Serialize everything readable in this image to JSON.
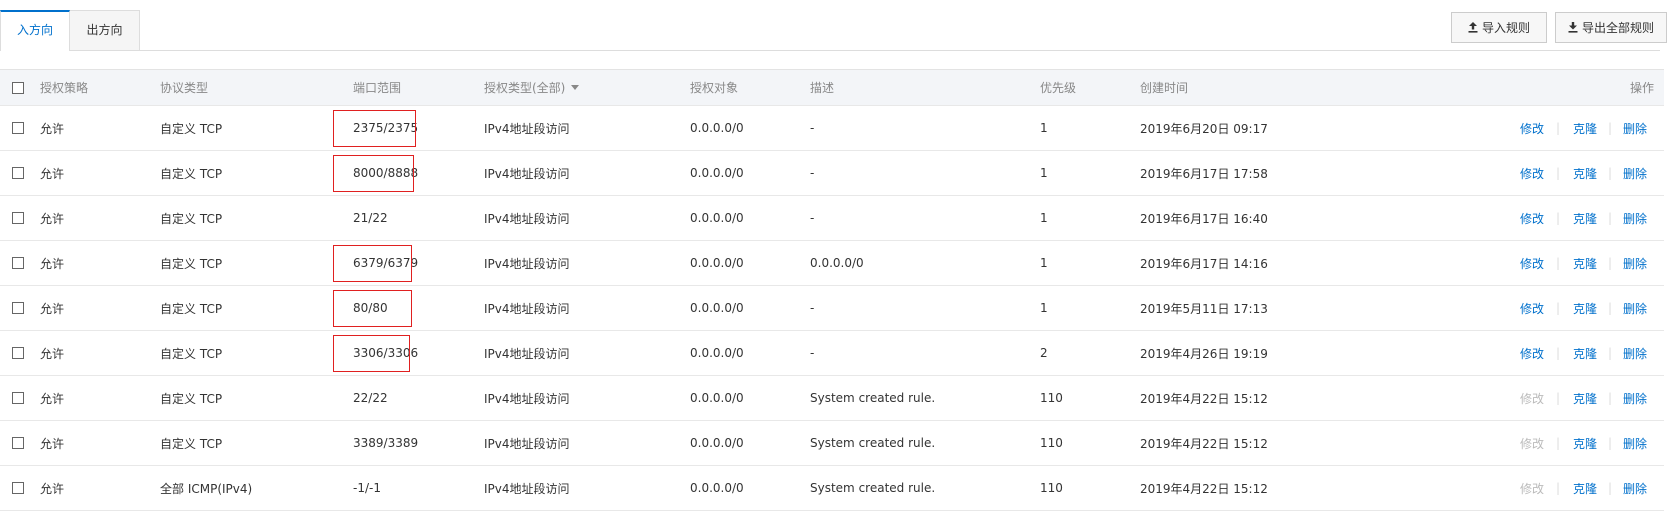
{
  "tabs": [
    {
      "label": "入方向",
      "active": true
    },
    {
      "label": "出方向",
      "active": false
    }
  ],
  "toolbar": {
    "import_label": "导入规则",
    "export_label": "导出全部规则"
  },
  "table": {
    "headers": {
      "policy": "授权策略",
      "protocol": "协议类型",
      "port": "端口范围",
      "auth_type": "授权类型(全部)",
      "target": "授权对象",
      "description": "描述",
      "priority": "优先级",
      "created": "创建时间",
      "ops": "操作"
    },
    "ops_labels": {
      "edit": "修改",
      "clone": "克隆",
      "delete": "删除",
      "separator": "|"
    },
    "rows": [
      {
        "policy": "允许",
        "protocol": "自定义 TCP",
        "port": "2375/2375",
        "auth_type": "IPv4地址段访问",
        "target": "0.0.0.0/0",
        "description": "-",
        "priority": "1",
        "created": "2019年6月20日 09:17",
        "edit_enabled": true,
        "highlighted": true
      },
      {
        "policy": "允许",
        "protocol": "自定义 TCP",
        "port": "8000/8888",
        "auth_type": "IPv4地址段访问",
        "target": "0.0.0.0/0",
        "description": "-",
        "priority": "1",
        "created": "2019年6月17日 17:58",
        "edit_enabled": true,
        "highlighted": true
      },
      {
        "policy": "允许",
        "protocol": "自定义 TCP",
        "port": "21/22",
        "auth_type": "IPv4地址段访问",
        "target": "0.0.0.0/0",
        "description": "-",
        "priority": "1",
        "created": "2019年6月17日 16:40",
        "edit_enabled": true,
        "highlighted": false
      },
      {
        "policy": "允许",
        "protocol": "自定义 TCP",
        "port": "6379/6379",
        "auth_type": "IPv4地址段访问",
        "target": "0.0.0.0/0",
        "description": "0.0.0.0/0",
        "priority": "1",
        "created": "2019年6月17日 14:16",
        "edit_enabled": true,
        "highlighted": true
      },
      {
        "policy": "允许",
        "protocol": "自定义 TCP",
        "port": "80/80",
        "auth_type": "IPv4地址段访问",
        "target": "0.0.0.0/0",
        "description": "-",
        "priority": "1",
        "created": "2019年5月11日 17:13",
        "edit_enabled": true,
        "highlighted": true
      },
      {
        "policy": "允许",
        "protocol": "自定义 TCP",
        "port": "3306/3306",
        "auth_type": "IPv4地址段访问",
        "target": "0.0.0.0/0",
        "description": "-",
        "priority": "2",
        "created": "2019年4月26日 19:19",
        "edit_enabled": true,
        "highlighted": true
      },
      {
        "policy": "允许",
        "protocol": "自定义 TCP",
        "port": "22/22",
        "auth_type": "IPv4地址段访问",
        "target": "0.0.0.0/0",
        "description": "System created rule.",
        "priority": "110",
        "created": "2019年4月22日 15:12",
        "edit_enabled": false,
        "highlighted": false
      },
      {
        "policy": "允许",
        "protocol": "自定义 TCP",
        "port": "3389/3389",
        "auth_type": "IPv4地址段访问",
        "target": "0.0.0.0/0",
        "description": "System created rule.",
        "priority": "110",
        "created": "2019年4月22日 15:12",
        "edit_enabled": false,
        "highlighted": false
      },
      {
        "policy": "允许",
        "protocol": "全部 ICMP(IPv4)",
        "port": "-1/-1",
        "auth_type": "IPv4地址段访问",
        "target": "0.0.0.0/0",
        "description": "System created rule.",
        "priority": "110",
        "created": "2019年4月22日 15:12",
        "edit_enabled": false,
        "highlighted": false
      }
    ]
  },
  "colors": {
    "accent": "#0070cc",
    "highlight_box": "#e02020",
    "disabled_link": "#bbbbbb"
  },
  "icons": {
    "import": "upload-icon",
    "export": "download-icon"
  }
}
